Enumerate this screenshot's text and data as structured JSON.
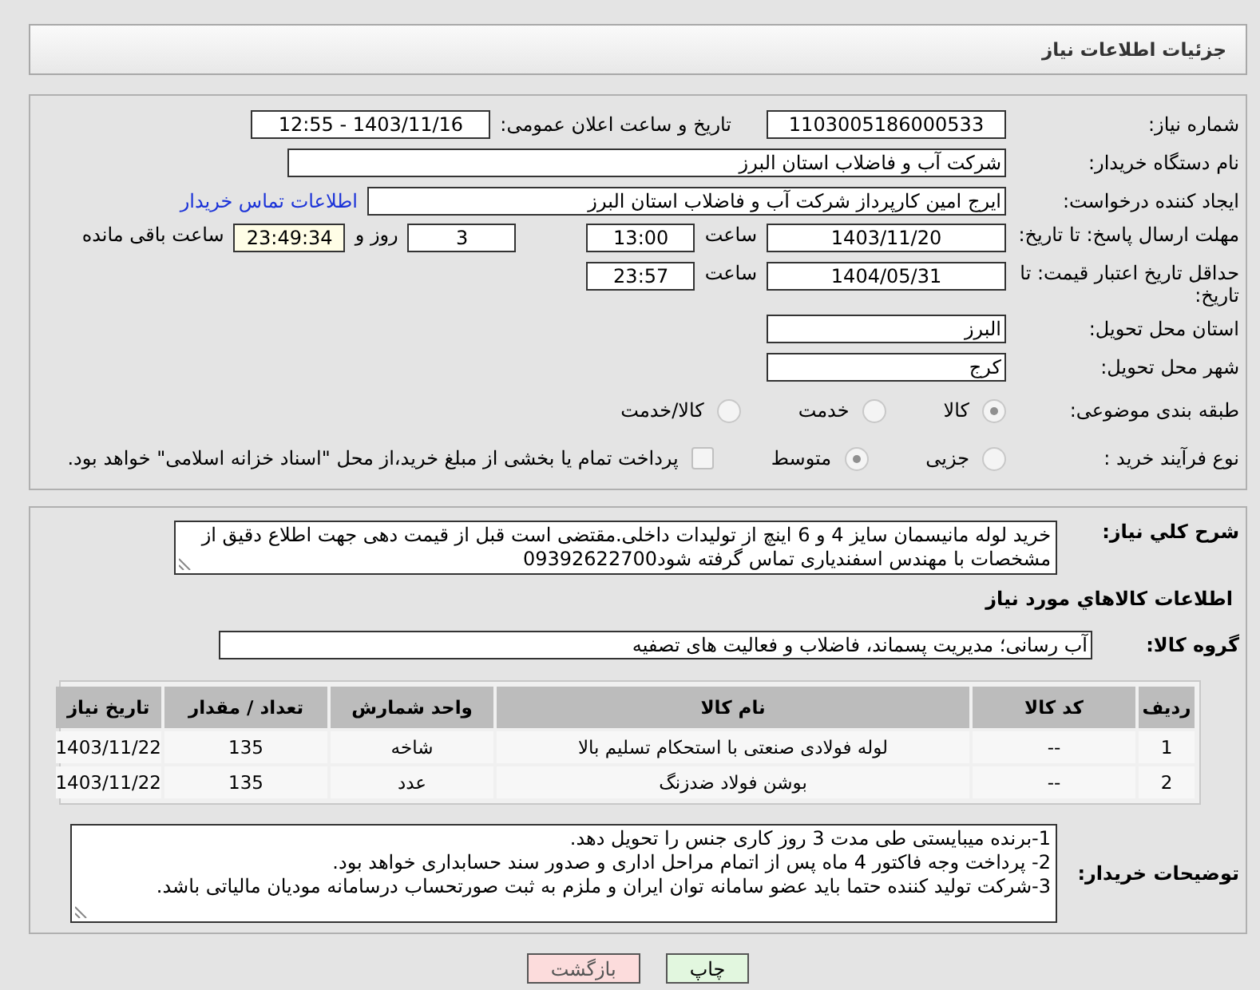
{
  "header": {
    "title": "جزئیات اطلاعات نیاز"
  },
  "need_number": {
    "label": "شماره نیاز:",
    "value": "1103005186000533"
  },
  "announce": {
    "label": "تاریخ و ساعت اعلان عمومی:",
    "value": "1403/11/16 - 12:55"
  },
  "buyer_org": {
    "label": "نام دستگاه خریدار:",
    "value": "شرکت آب و فاضلاب استان البرز"
  },
  "requester": {
    "label": "ایجاد کننده درخواست:",
    "value": "ایرج امین کارپرداز شرکت آب و فاضلاب استان البرز",
    "link": "اطلاعات تماس خریدار"
  },
  "deadline": {
    "label": "مهلت ارسال پاسخ: تا تاریخ:",
    "date": "1403/11/20",
    "time_label": "ساعت",
    "time": "13:00",
    "days": "3",
    "days_label": "روز و",
    "remaining": "23:49:34",
    "remaining_label": "ساعت باقی مانده"
  },
  "validity": {
    "label": "حداقل تاریخ اعتبار قیمت: تا تاریخ:",
    "date": "1404/05/31",
    "time_label": "ساعت",
    "time": "23:57"
  },
  "province": {
    "label": "استان محل تحویل:",
    "value": "البرز"
  },
  "city": {
    "label": "شهر محل تحویل:",
    "value": "کرج"
  },
  "category": {
    "label": "طبقه بندی موضوعی:",
    "options": [
      {
        "label": "کالا",
        "selected": true
      },
      {
        "label": "خدمت",
        "selected": false
      },
      {
        "label": "کالا/خدمت",
        "selected": false
      }
    ]
  },
  "process": {
    "label": "نوع فرآیند خرید :",
    "options": [
      {
        "label": "جزیی",
        "selected": false
      },
      {
        "label": "متوسط",
        "selected": true
      }
    ],
    "payment": {
      "checked": false,
      "text": "پرداخت تمام یا بخشی از مبلغ خرید،از محل \"اسناد خزانه اسلامی\" خواهد بود."
    }
  },
  "description": {
    "label": "شرح كلي نياز:",
    "text": "خرید لوله مانیسمان سایز 4 و 6 اینچ از تولیدات داخلی.مقتضی است  قبل از قیمت دهی جهت اطلاع دقیق از مشخصات با مهندس اسفندیاری تماس گرفته شود09392622700"
  },
  "goods_title": "اطلاعات كالاهاي مورد نياز",
  "goods_group": {
    "label": "گروه کالا:",
    "value": "آب رسانی؛ مدیریت پسماند، فاضلاب و فعالیت های تصفیه"
  },
  "table": {
    "columns": [
      "ردیف",
      "کد کالا",
      "نام کالا",
      "واحد شمارش",
      "تعداد / مقدار",
      "تاریخ نیاز"
    ],
    "rows": [
      [
        "1",
        "--",
        "لوله فولادی صنعتی با استحکام تسلیم بالا",
        "شاخه",
        "135",
        "1403/11/22"
      ],
      [
        "2",
        "--",
        "بوشن فولاد ضدزنگ",
        "عدد",
        "135",
        "1403/11/22"
      ]
    ]
  },
  "buyer_notes": {
    "label": "توضیحات خریدار:",
    "lines": [
      "1-برنده میبایستی طی مدت 3 روز کاری جنس را تحویل دهد.",
      "2- پرداخت وجه فاکتور 4 ماه پس از اتمام مراحل اداری و صدور سند حسابداری خواهد بود.",
      "3-شرکت تولید کننده حتما باید عضو سامانه توان ایران و ملزم به ثبت صورتحساب درسامانه مودیان مالیاتی باشد."
    ]
  },
  "buttons": [
    {
      "label": "چاپ",
      "kind": "print"
    },
    {
      "label": "بازگشت",
      "kind": "back"
    }
  ]
}
